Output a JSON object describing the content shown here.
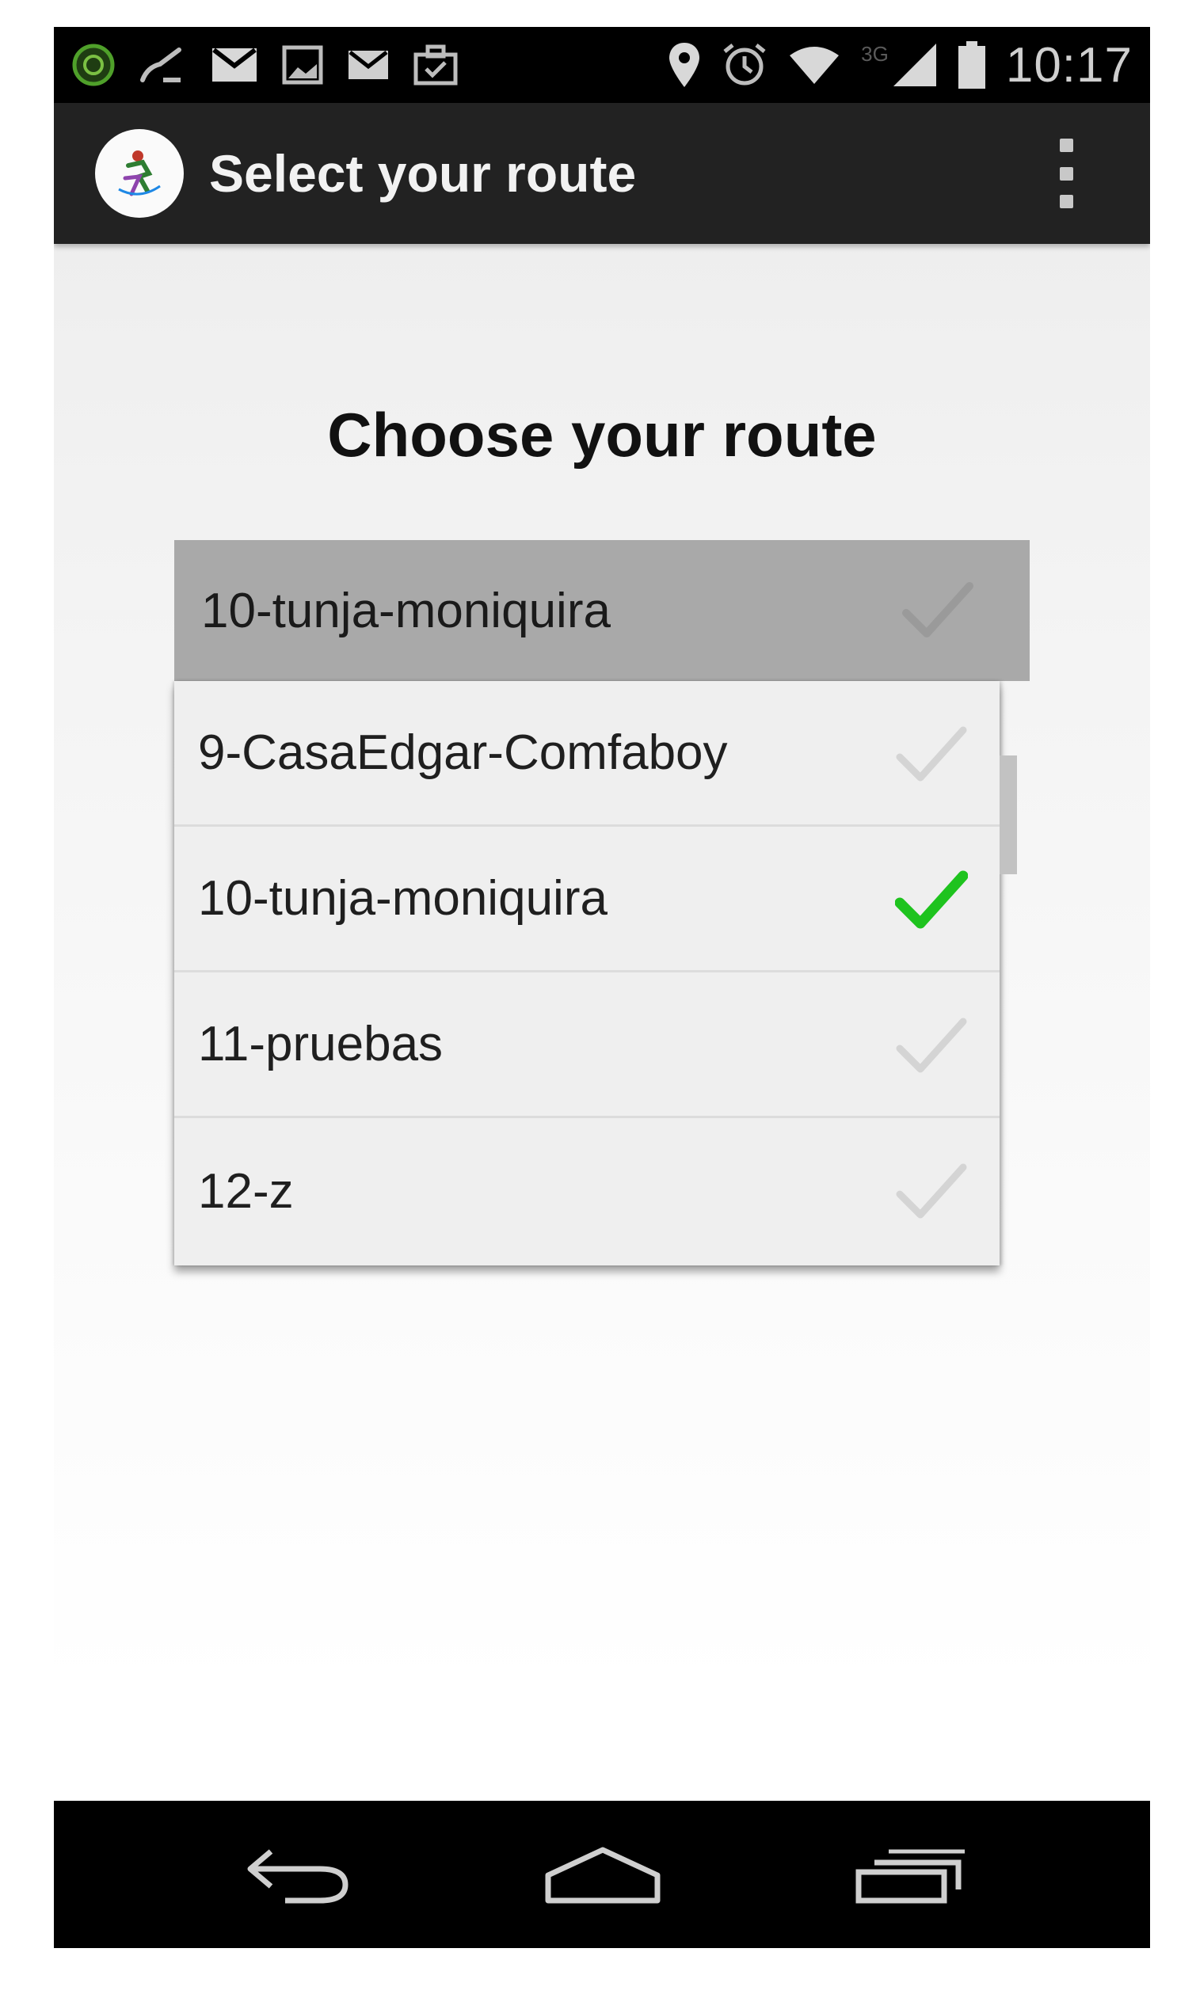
{
  "status_bar": {
    "time": "10:17",
    "network_type": "3G",
    "left_icons": [
      "app-notification-icon",
      "missed-call-icon",
      "gmail-icon",
      "image-icon",
      "email-icon",
      "briefcase-icon"
    ],
    "right_icons": [
      "location-icon",
      "alarm-icon",
      "wifi-icon",
      "signal-icon",
      "battery-icon"
    ]
  },
  "action_bar": {
    "title": "Select your route",
    "logo_icon": "app-logo-icon",
    "menu_icon": "overflow-menu-icon"
  },
  "main": {
    "heading": "Choose your route",
    "spinner": {
      "selected_value": "10-tunja-moniquira"
    },
    "dropdown": {
      "items": [
        {
          "label": "9-CasaEdgar-Comfaboy",
          "checked": false
        },
        {
          "label": "10-tunja-moniquira",
          "checked": true
        },
        {
          "label": "11-pruebas",
          "checked": false
        },
        {
          "label": "12-z",
          "checked": false
        }
      ]
    }
  },
  "nav_bar": {
    "icons": [
      "back-icon",
      "home-icon",
      "recent-apps-icon"
    ]
  },
  "colors": {
    "check_active": "#1ec31e",
    "check_inactive": "#d4d4d4",
    "action_bar_bg": "#222222",
    "spinner_bg": "#a9a9a9"
  }
}
